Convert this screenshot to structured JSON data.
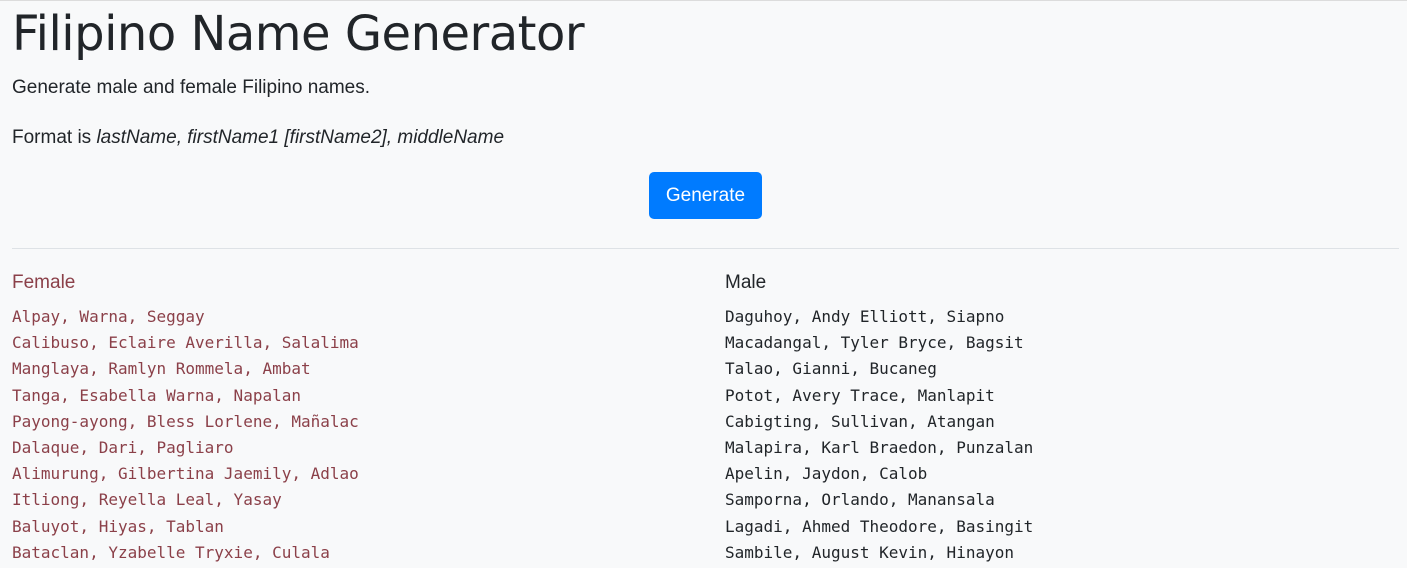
{
  "page": {
    "title": "Filipino Name Generator",
    "lead": "Generate male and female Filipino names.",
    "format_prefix": "Format is ",
    "format_spec": "lastName, firstName1 [firstName2], middleName"
  },
  "controls": {
    "generate_label": "Generate"
  },
  "female": {
    "heading": "Female",
    "color": "#8b4049",
    "names": [
      "Alpay, Warna, Seggay",
      "Calibuso, Eclaire Averilla, Salalima",
      "Manglaya, Ramlyn Rommela, Ambat",
      "Tanga, Esabella Warna, Napalan",
      "Payong-ayong, Bless Lorlene, Mañalac",
      "Dalaque, Dari, Pagliaro",
      "Alimurung, Gilbertina Jaemily, Adlao",
      "Itliong, Reyella Leal, Yasay",
      "Baluyot, Hiyas, Tablan",
      "Bataclan, Yzabelle Tryxie, Culala"
    ]
  },
  "male": {
    "heading": "Male",
    "color": "#212529",
    "names": [
      "Daguhoy, Andy Elliott, Siapno",
      "Macadangal, Tyler Bryce, Bagsit",
      "Talao, Gianni, Bucaneg",
      "Potot, Avery Trace, Manlapit",
      "Cabigting, Sullivan, Atangan",
      "Malapira, Karl Braedon, Punzalan",
      "Apelin, Jaydon, Calob",
      "Samporna, Orlando, Manansala",
      "Lagadi, Ahmed Theodore, Basingit",
      "Sambile, August Kevin, Hinayon"
    ]
  },
  "theme": {
    "primary": "#007bff",
    "background": "#f8f9fa"
  }
}
